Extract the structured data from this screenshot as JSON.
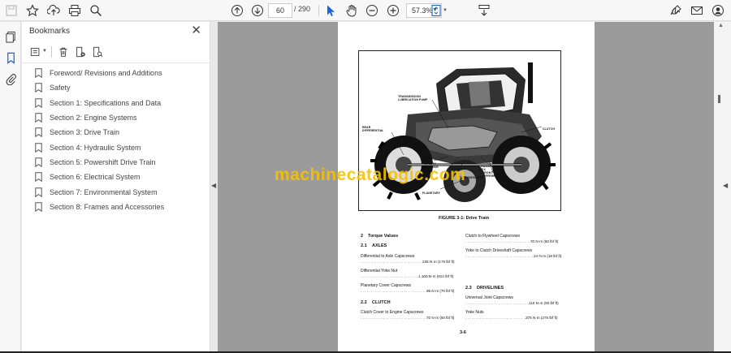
{
  "toolbar": {
    "page_current": "60",
    "page_total": "/ 290",
    "zoom": "57.3%",
    "icons": [
      "save-icon",
      "star-icon",
      "upload-icon",
      "print-icon",
      "search-icon",
      "page-up-icon",
      "page-down-icon",
      "select-cursor-icon",
      "hand-icon",
      "zoom-out-icon",
      "zoom-in-icon",
      "fit-page-icon",
      "scroll-mode-icon",
      "sign-icon",
      "mail-icon",
      "account-icon"
    ]
  },
  "panel": {
    "title": "Bookmarks",
    "close": "✕",
    "bookmarks": [
      "Foreword/ Revisions and Additions",
      "Safety",
      "Section 1:  Specifications and Data",
      "Section 2:  Engine Systems",
      "Section 3:  Drive Train",
      "Section 4:  Hydraulic System",
      "Section 5:  Powershift Drive Train",
      "Section 6:  Electrical System",
      "Section 7:  Environmental System",
      "Section 8:  Frames and Accessories"
    ]
  },
  "document": {
    "figure_caption": "FIGURE 3-1:  Drive Train",
    "figure_labels": {
      "transmission_lub": "TRANSMISSION\nLUBRICATION PUMP",
      "rear_diff": "REAR\nDIFFERENTIAL",
      "clutch": "CLUTCH",
      "utility_bearing": "UTILITY\nBEARING",
      "hydraulic_pump": "HYDRAULIC\nPUMP",
      "transmission": "TRANSMISSION",
      "transfer_box": "TRANSFER\nBOX",
      "front_diff": "FRONT\nDIFFERENTIAL",
      "planetary": "PLANETARY"
    },
    "left_col": {
      "section_num": "2",
      "section_title": "Torque Values",
      "s21_num": "2.1",
      "s21_title": "AXLES",
      "item1": "Differential to Axle Capscrews",
      "val1": "235 N·m (175 lbf ft)",
      "item2": "Differential Yoke Nut",
      "val2": "1 100 N·m (812 lbf ft)",
      "item3": "Planetary Cover Capscrews",
      "val3": "95 N·m (70 lbf ft)",
      "s22_num": "2.2",
      "s22_title": "CLUTCH",
      "item4": "Clutch Cover to Engine Capscrews",
      "val4": "70 N·m (50 lbf ft)"
    },
    "right_col": {
      "item1": "Clutch to Flywheel Capscrews",
      "val1": "70 N·m (50 lbf ft)",
      "item2": "Yoke to Clutch Driveshaft Capscrews",
      "val2": "24 N·m (18 lbf ft)",
      "s23_num": "2.3",
      "s23_title": "DRIVELINES",
      "item3": "Universal Joint Capscrews",
      "val3": "110 N·m (90 lbf ft)",
      "item4": "Yoke Nuts",
      "val4": "375 N·m (275 lbf ft)"
    },
    "page_number": "3-6",
    "watermark": "machinecatalogic.com"
  }
}
